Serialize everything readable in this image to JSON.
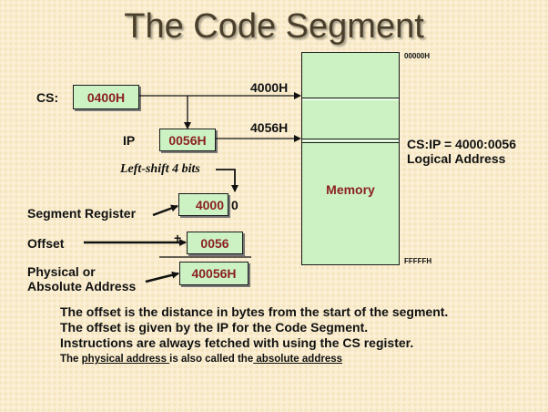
{
  "title": "The Code Segment",
  "registers": {
    "cs_label": "CS:",
    "cs_value": "0400H",
    "ip_label": "IP",
    "ip_value": "0056H"
  },
  "arrow_labels": {
    "segment_address": "4000H",
    "physical_address": "4056H"
  },
  "shift_note": "Left-shift 4 bits",
  "memory": {
    "label": "Memory",
    "top_address": "00000H",
    "bottom_address": "FFFFFH"
  },
  "logical": {
    "csip": "CS:IP = 4000:0056",
    "caption": "Logical Address"
  },
  "calculation": {
    "segment_register_label": "Segment Register",
    "segment_register_value": "4000",
    "shift_digit": "0",
    "offset_label": "Offset",
    "plus_sign": "+",
    "offset_value": "0056",
    "physical_label_1": "Physical or",
    "physical_label_2": "Absolute Address",
    "physical_value": "40056H"
  },
  "notes": {
    "line1": "The offset is the distance in bytes from the start of the segment.",
    "line2": "The offset is given by the IP for the Code Segment.",
    "line3": "Instructions are always fetched with using  the CS register.",
    "line4_pre": "The ",
    "line4_term1": "physical address ",
    "line4_mid": " is also called the",
    "line4_term2": " absolute address"
  },
  "colors": {
    "box_fill": "#ccf2c4",
    "box_text": "#8b1f1f",
    "background": "#fbf0d6"
  }
}
